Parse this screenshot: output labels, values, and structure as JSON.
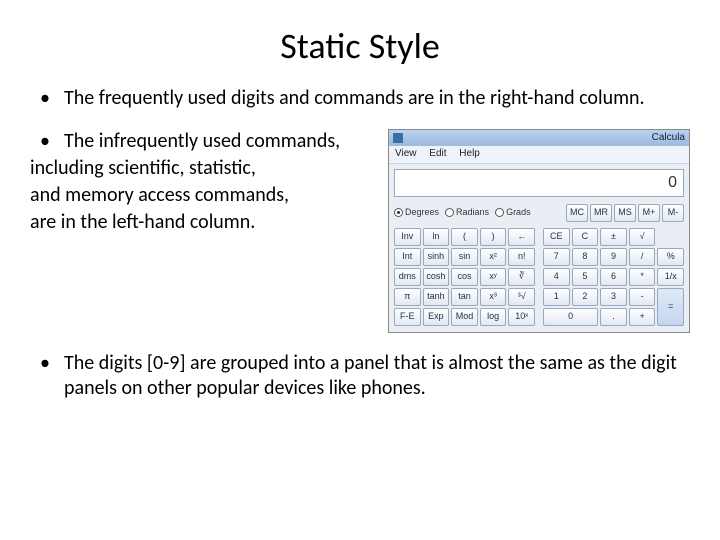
{
  "title": "Static Style",
  "bullet1": "The frequently used digits and commands are in the right-hand column.",
  "bullet2_lead": "The infrequently used commands,",
  "bullet2_line2": "including scientific, statistic,",
  "bullet2_line3": "and memory access commands,",
  "bullet2_line4": "are in the left-hand column.",
  "bullet3": "The digits [0-9] are grouped into a panel that is almost the same as the digit panels on other popular devices like phones.",
  "calc": {
    "title": "Calcula",
    "menu": {
      "view": "View",
      "edit": "Edit",
      "help": "Help"
    },
    "display": "0",
    "modes": {
      "deg": "Degrees",
      "rad": "Radians",
      "grad": "Grads"
    },
    "mem": [
      "MC",
      "MR",
      "MS",
      "M+",
      "M-"
    ],
    "rows": [
      [
        "Inv",
        "ln",
        "(",
        ")",
        "←",
        "CE",
        "C",
        "±",
        "√",
        ""
      ],
      [
        "Int",
        "sinh",
        "sin",
        "x²",
        "n!",
        "7",
        "8",
        "9",
        "/",
        "%"
      ],
      [
        "dms",
        "cosh",
        "cos",
        "xʸ",
        "∛",
        "4",
        "5",
        "6",
        "*",
        "1/x"
      ],
      [
        "π",
        "tanh",
        "tan",
        "x³",
        "³√",
        "1",
        "2",
        "3",
        "-",
        "="
      ],
      [
        "F-E",
        "Exp",
        "Mod",
        "log",
        "10ˣ",
        "0",
        "",
        ".",
        "+",
        ""
      ]
    ]
  }
}
